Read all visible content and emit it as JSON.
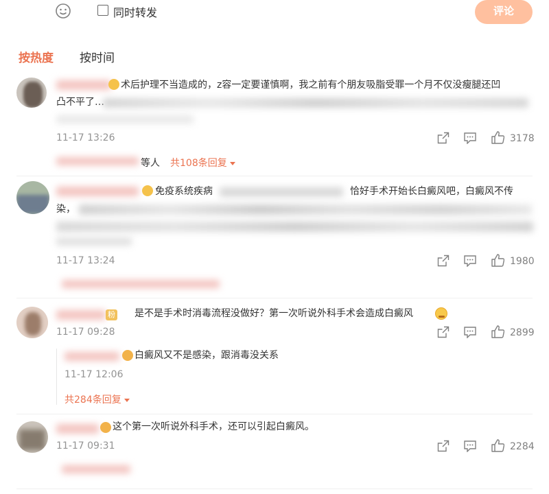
{
  "composer": {
    "smiley_icon": "smiley-icon",
    "repost_label": "同时转发",
    "submit_label": "评论"
  },
  "tabs": [
    {
      "label": "按热度",
      "active": true
    },
    {
      "label": "按时间",
      "active": false
    }
  ],
  "comments": [
    {
      "line1": "术后护理不当造成的，z容一定要谨慎啊，我之前有个朋友吸脂受罪一个月不仅没瘦腿还凹",
      "line2": "凸不平了…",
      "time": "11-17 13:26",
      "likes": "3178",
      "reply_tail": "等人",
      "reply_count": "共108条回复"
    },
    {
      "line1": "免疫系统疾病",
      "line1_end": "恰好手术开始长白癜风吧，白癜风不传",
      "line2": "染，",
      "time": "11-17 13:24",
      "likes": "1980"
    },
    {
      "badge": "粉",
      "text": "是不是手术时消毒流程没做好？第一次听说外科手术会造成白癜风",
      "time": "11-17 09:28",
      "likes": "2899",
      "reply": {
        "text": "白癜风又不是感染，跟消毒没关系",
        "time": "11-17 12:06"
      },
      "reply_count": "共284条回复"
    },
    {
      "text": "这个第一次听说外科手术，还可以引起白癜风。",
      "time": "11-17 09:31",
      "likes": "2284"
    }
  ],
  "colors": {
    "accent": "#eb7350",
    "submit_bg": "#ffc09f",
    "muted": "#939393"
  }
}
